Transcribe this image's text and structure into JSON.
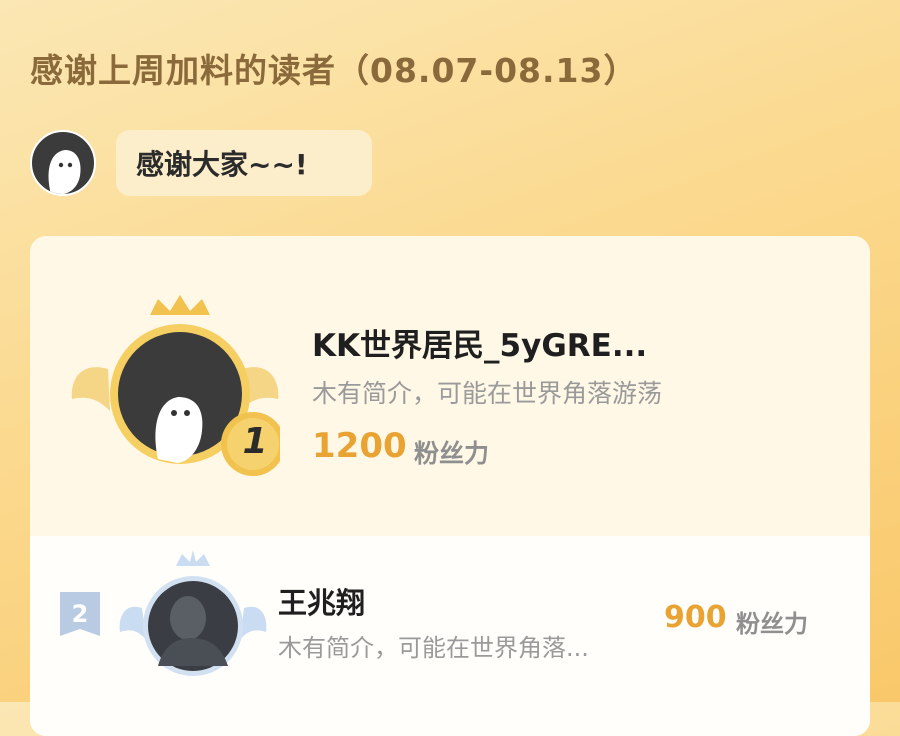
{
  "header": {
    "title": "感谢上周加料的读者（08.07-08.13）"
  },
  "message": {
    "text": "感谢大家~~!"
  },
  "leaderboard": {
    "first": {
      "rank": "1",
      "name": "KK世界居民_5yGRE...",
      "bio": "木有简介，可能在世界角落游荡",
      "score": "1200",
      "unit": "粉丝力"
    },
    "second": {
      "rank": "2",
      "name": "王兆翔",
      "bio": "木有简介，可能在世界角落...",
      "score": "900",
      "unit": "粉丝力"
    }
  },
  "colors": {
    "accent": "#e9a332",
    "gold": "#f1c24d",
    "silver": "#b9cbe3"
  }
}
